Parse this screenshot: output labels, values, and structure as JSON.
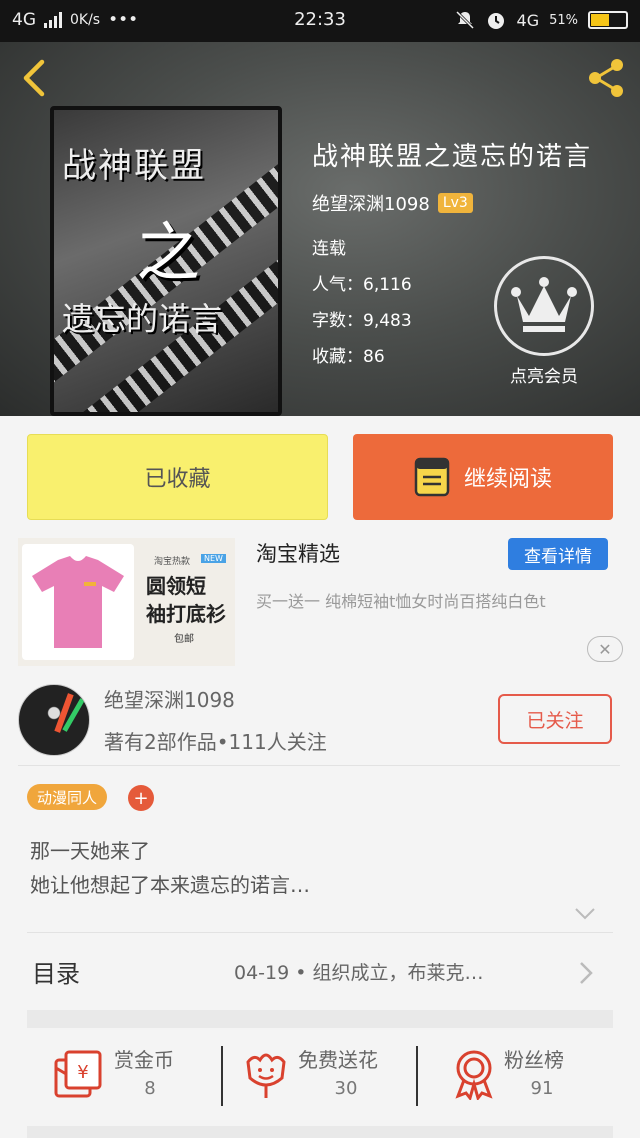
{
  "status_bar": {
    "network": "4G",
    "speed": "0K/s",
    "dots": "•••",
    "time": "22:33",
    "network_right": "4G",
    "battery": "51%"
  },
  "book": {
    "cover_title_1": "战神联盟",
    "cover_title_2": "之",
    "cover_title_3": "遗忘的诺言",
    "title": "战神联盟之遗忘的诺言",
    "author": "绝望深渊1098",
    "level": "Lv3",
    "status": "连载",
    "popularity": "人气：6,116",
    "word_count": "字数：9,483",
    "favorites": "收藏：86"
  },
  "vip": {
    "label": "点亮会员"
  },
  "actions": {
    "collected_label": "已收藏",
    "continue_label": "继续阅读"
  },
  "ad": {
    "title": "淘宝精选",
    "button": "查看详情",
    "description": "买一送一 纯棉短袖t恤女时尚百搭纯白色t",
    "image_tag": "淘宝热款",
    "image_tag2": "NEW",
    "image_line1": "圆领短",
    "image_line2": "袖打底衫",
    "image_line3": "包邮",
    "close": "✕"
  },
  "author_card": {
    "name": "绝望深渊1098",
    "stats": "著有2部作品•111人关注",
    "follow_label": "已关注"
  },
  "tags": {
    "items": [
      "动漫同人"
    ],
    "add": "+"
  },
  "synopsis": {
    "line1": "那一天她来了",
    "line2": "她让他想起了本来遗忘的诺言…"
  },
  "toc": {
    "label": "目录",
    "latest": "04-19 • 组织成立，布莱克…"
  },
  "rewards": {
    "coins_label": "赏金币",
    "coins_count": "8",
    "flowers_label": "免费送花",
    "flowers_count": "30",
    "fans_label": "粉丝榜",
    "fans_count": "91"
  },
  "colors": {
    "orange": "#ed6a3b",
    "yellow": "#f9f06e",
    "blue": "#2f7ee0",
    "red": "#e55a4a"
  }
}
